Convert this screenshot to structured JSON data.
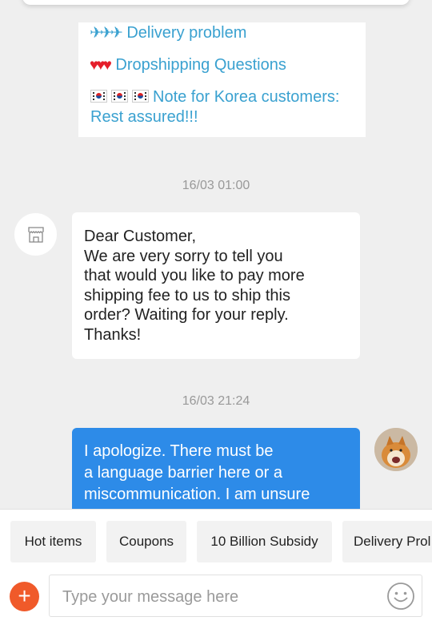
{
  "faq": {
    "item1": {
      "icons": "✈✈✈",
      "label": "Delivery problem"
    },
    "item2": {
      "icons": "♥♥♥",
      "label": "Dropshipping Questions"
    },
    "item3": {
      "line1": "Note for Korea customers:",
      "line2": "Rest assured!!!"
    }
  },
  "messages": {
    "ts1": "16/03 01:00",
    "incoming": "Dear Customer,\nWe are very sorry to tell you\nthat would you like to pay more\nshipping fee to us to ship this\norder? Waiting for your reply.\nThanks!",
    "ts2": "16/03 21:24",
    "outgoing": "I apologize. There must be\na language barrier here or a\nmiscommunication. I am unsure"
  },
  "quick_replies": [
    "Hot items",
    "Coupons",
    "10 Billion Subsidy",
    "Delivery Prol"
  ],
  "composer": {
    "placeholder": "Type your message here",
    "plus": "+"
  },
  "colors": {
    "accent": "#2d8be8",
    "link": "#3aa1d0",
    "plus": "#f05a2a"
  }
}
